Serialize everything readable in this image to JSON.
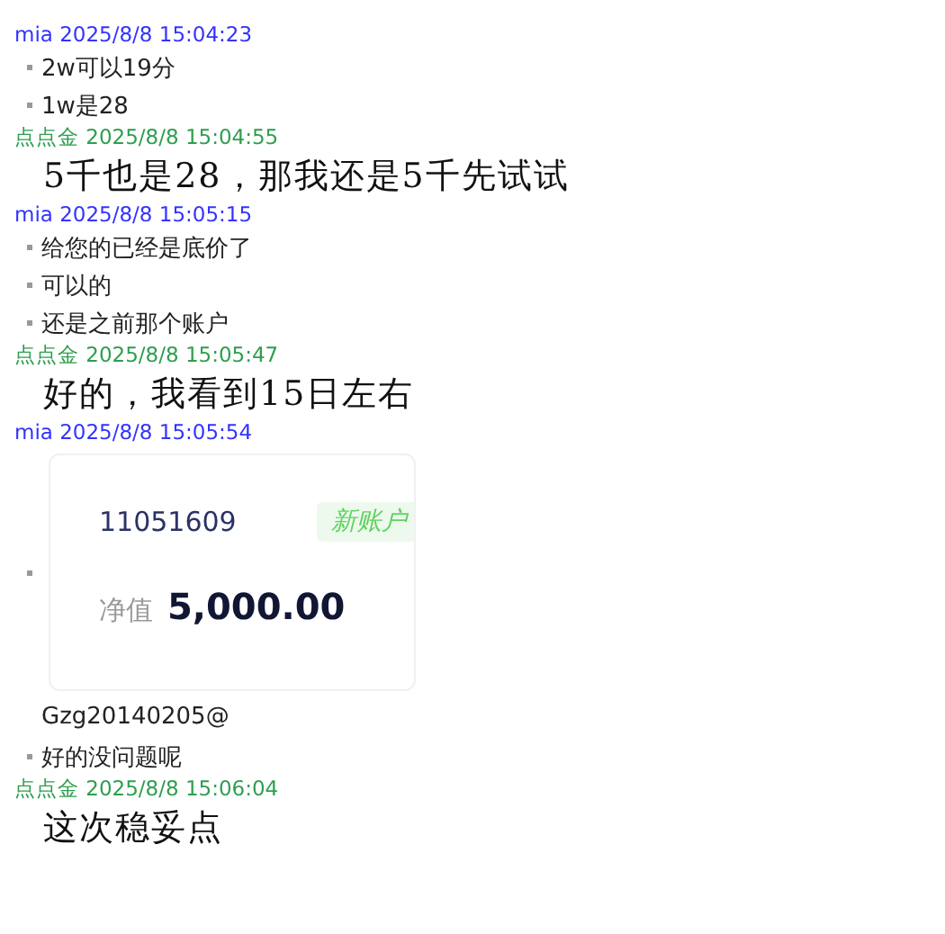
{
  "messages": [
    {
      "sender": "mia",
      "color": "#3333ff",
      "time": "2025/8/8 15:04:23",
      "items": [
        {
          "kind": "bullet",
          "text": "2w可以19分"
        },
        {
          "kind": "bullet",
          "text": "1w是28"
        }
      ]
    },
    {
      "sender": "点点金",
      "color": "#2e9e4f",
      "time": "2025/8/8 15:04:55",
      "items": [
        {
          "kind": "big",
          "text": "5千也是28，那我还是5千先试试"
        }
      ]
    },
    {
      "sender": "mia",
      "color": "#3333ff",
      "time": "2025/8/8 15:05:15",
      "items": [
        {
          "kind": "bullet",
          "text": "给您的已经是底价了"
        },
        {
          "kind": "bullet",
          "text": "可以的"
        },
        {
          "kind": "bullet",
          "text": "还是之前那个账户"
        }
      ]
    },
    {
      "sender": "点点金",
      "color": "#2e9e4f",
      "time": "2025/8/8 15:05:47",
      "items": [
        {
          "kind": "big",
          "text": "好的，我看到15日左右"
        }
      ]
    },
    {
      "sender": "mia",
      "color": "#3333ff",
      "time": "2025/8/8 15:05:54",
      "items": [
        {
          "kind": "card",
          "account": "11051609",
          "badge": "新账户",
          "label": "净值",
          "value": "5,000.00"
        },
        {
          "kind": "plain",
          "text": "Gzg20140205@"
        },
        {
          "kind": "bullet",
          "text": "好的没问题呢"
        }
      ]
    },
    {
      "sender": "点点金",
      "color": "#2e9e4f",
      "time": "2025/8/8 15:06:04",
      "items": [
        {
          "kind": "big",
          "text": "这次稳妥点"
        }
      ]
    }
  ]
}
